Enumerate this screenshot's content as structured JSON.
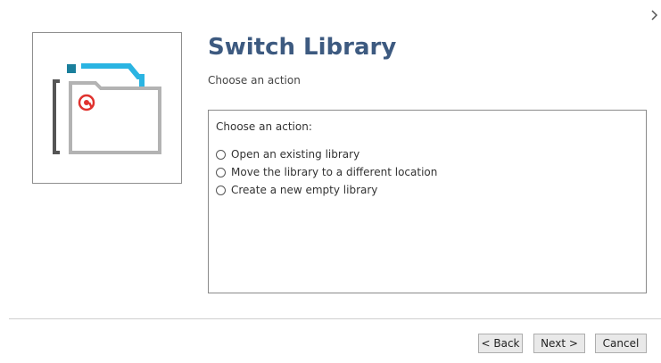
{
  "dialog": {
    "title": "Switch Library",
    "subtitle": "Choose an action",
    "close_icon": "chevron-right-icon",
    "logo_icon": "library-folder-icon"
  },
  "actions": {
    "group_label": "Choose an action:",
    "options": [
      {
        "label": "Open an existing library",
        "selected": false
      },
      {
        "label": "Move the library to a different location",
        "selected": false
      },
      {
        "label": "Create a new empty library",
        "selected": false
      }
    ]
  },
  "buttons": {
    "back": "< Back",
    "next": "Next >",
    "cancel": "Cancel"
  },
  "colors": {
    "title": "#3d5a80",
    "logo_teal": "#1a7f9c",
    "logo_cyan": "#2ab4e2",
    "logo_red": "#e0322e",
    "logo_gray": "#b3b3b3",
    "logo_dark_gray": "#555555"
  }
}
